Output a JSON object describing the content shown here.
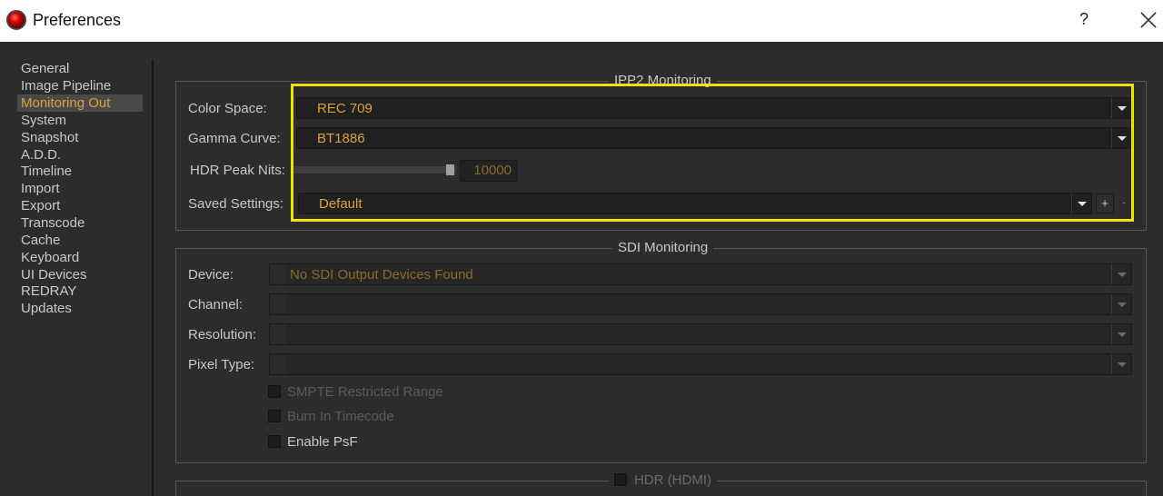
{
  "window": {
    "title": "Preferences",
    "help_label": "?",
    "close_icon": "close-icon",
    "app_icon": "red-lens-icon"
  },
  "sidebar": {
    "items": [
      {
        "label": "General",
        "active": false
      },
      {
        "label": "Image Pipeline",
        "active": false
      },
      {
        "label": "Monitoring Out",
        "active": true
      },
      {
        "label": "System",
        "active": false
      },
      {
        "label": "Snapshot",
        "active": false
      },
      {
        "label": "A.D.D.",
        "active": false
      },
      {
        "label": "Timeline",
        "active": false
      },
      {
        "label": "Import",
        "active": false
      },
      {
        "label": "Export",
        "active": false
      },
      {
        "label": "Transcode",
        "active": false
      },
      {
        "label": "Cache",
        "active": false
      },
      {
        "label": "Keyboard",
        "active": false
      },
      {
        "label": "UI Devices",
        "active": false
      },
      {
        "label": "REDRAY",
        "active": false
      },
      {
        "label": "Updates",
        "active": false
      }
    ]
  },
  "ipp2": {
    "group_title": "IPP2 Monitoring",
    "color_space": {
      "label": "Color Space:",
      "value": "REC 709"
    },
    "gamma_curve": {
      "label": "Gamma Curve:",
      "value": "BT1886"
    },
    "hdr_peak_nits": {
      "label": "HDR Peak Nits:",
      "value": "10000",
      "slider_fraction": 1.0
    },
    "saved_settings": {
      "label": "Saved Settings:",
      "value": "Default",
      "add_label": "+",
      "remove_label": "-"
    }
  },
  "sdi": {
    "group_title": "SDI Monitoring",
    "device": {
      "label": "Device:",
      "value": "No SDI Output Devices Found"
    },
    "channel": {
      "label": "Channel:",
      "value": ""
    },
    "resolution": {
      "label": "Resolution:",
      "value": ""
    },
    "pixel_type": {
      "label": "Pixel Type:",
      "value": ""
    },
    "smpte_restricted_range": {
      "label": "SMPTE Restricted Range",
      "checked": false,
      "enabled": false
    },
    "burn_in_timecode": {
      "label": "Burn In Timecode",
      "checked": false,
      "enabled": false
    },
    "enable_psf": {
      "label": "Enable PsF",
      "checked": false,
      "enabled": true
    }
  },
  "hdr": {
    "group_title": "HDR (HDMI)",
    "checked": false
  },
  "colors": {
    "accent": "#d9a33a",
    "highlight": "#e8e600",
    "background": "#2c2c2c"
  }
}
